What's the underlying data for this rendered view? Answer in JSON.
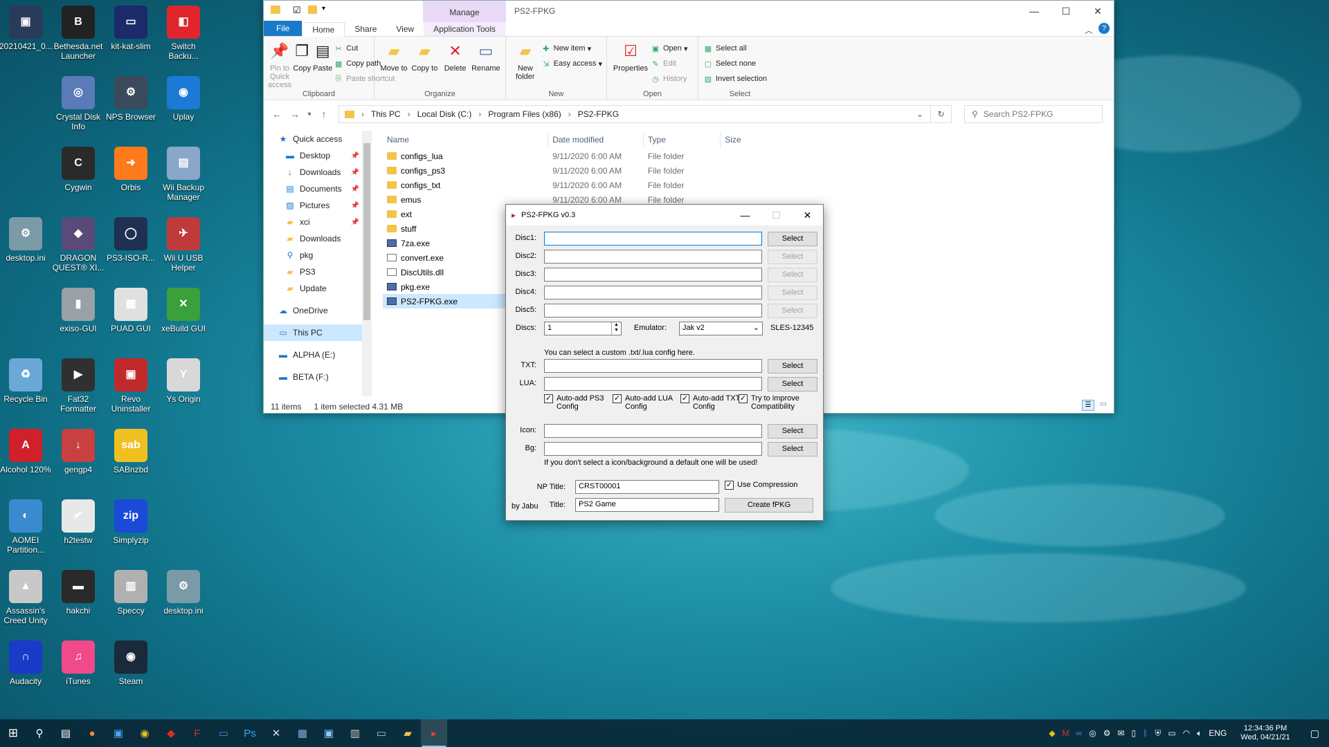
{
  "desktop": {
    "icons": [
      {
        "label": "20210421_0...",
        "color": "#2a3a5a",
        "glyph": "▣"
      },
      {
        "label": "Bethesda.net Launcher",
        "color": "#222222",
        "glyph": "B"
      },
      {
        "label": "kit-kat-slim",
        "color": "#1a2a6a",
        "glyph": "▭"
      },
      {
        "label": "Switch Backu...",
        "color": "#e0262c",
        "glyph": "◧"
      },
      {
        "label": "Crystal Disk Info",
        "color": "#5a7ab8",
        "glyph": "◎"
      },
      {
        "label": "NPS Browser",
        "color": "#3b4a5a",
        "glyph": "⚙"
      },
      {
        "label": "Uplay",
        "color": "#1b7ad6",
        "glyph": "◉"
      },
      {
        "label": "Cygwin",
        "color": "#2a2a2a",
        "glyph": "C"
      },
      {
        "label": "Orbis",
        "color": "#ff7a1a",
        "glyph": "➜"
      },
      {
        "label": "Wii Backup Manager",
        "color": "#8aa6c8",
        "glyph": "▤"
      },
      {
        "label": "desktop.ini",
        "color": "#7a9aa8",
        "glyph": "⚙"
      },
      {
        "label": "DRAGON QUEST® XI...",
        "color": "#5a4a7a",
        "glyph": "◆"
      },
      {
        "label": "PS3-ISO-R...",
        "color": "#203050",
        "glyph": "◯"
      },
      {
        "label": "Wii U USB Helper",
        "color": "#c03a3a",
        "glyph": "✈"
      },
      {
        "label": "exiso-GUI",
        "color": "#9aa0a8",
        "glyph": "▮"
      },
      {
        "label": "PUAD GUI",
        "color": "#e0e0e0",
        "glyph": "▦"
      },
      {
        "label": "xeBuild GUI",
        "color": "#3aa03a",
        "glyph": "✕"
      },
      {
        "label": "Recycle Bin",
        "color": "#6aa8d8",
        "glyph": "♻"
      },
      {
        "label": "Fat32 Formatter",
        "color": "#303030",
        "glyph": "▶"
      },
      {
        "label": "Revo Uninstaller",
        "color": "#c02a2a",
        "glyph": "▣"
      },
      {
        "label": "Ys Origin",
        "color": "#d8d8d8",
        "glyph": "Y"
      },
      {
        "label": "Alcohol 120%",
        "color": "#d0202a",
        "glyph": "A"
      },
      {
        "label": "gengp4",
        "color": "#c84040",
        "glyph": "↓"
      },
      {
        "label": "SABnzbd",
        "color": "#f0c020",
        "glyph": "sab"
      },
      {
        "label": "AOMEI Partition...",
        "color": "#3a8ad0",
        "glyph": "◐"
      },
      {
        "label": "h2testw",
        "color": "#e8e8e8",
        "glyph": "✔"
      },
      {
        "label": "Simplyzip",
        "color": "#1a4ad8",
        "glyph": "zip"
      },
      {
        "label": "Assassin's Creed Unity",
        "color": "#c8c8c8",
        "glyph": "▲"
      },
      {
        "label": "hakchi",
        "color": "#2a2a2a",
        "glyph": "▬"
      },
      {
        "label": "Speccy",
        "color": "#b0b0b0",
        "glyph": "▥"
      },
      {
        "label": "desktop.ini",
        "color": "#7a9aa8",
        "glyph": "⚙"
      },
      {
        "label": "Audacity",
        "color": "#1a3ac8",
        "glyph": "∩"
      },
      {
        "label": "iTunes",
        "color": "#f04a8a",
        "glyph": "♫"
      },
      {
        "label": "Steam",
        "color": "#1a2a3a",
        "glyph": "◉"
      }
    ]
  },
  "explorer": {
    "manage_label": "Manage",
    "window_title": "PS2-FPKG",
    "tabs": {
      "file": "File",
      "home": "Home",
      "share": "Share",
      "view": "View",
      "app_tools": "Application Tools"
    },
    "ribbon": {
      "pin": "Pin to Quick access",
      "copy": "Copy",
      "paste": "Paste",
      "cut": "Cut",
      "copy_path": "Copy path",
      "paste_shortcut": "Paste shortcut",
      "clipboard": "Clipboard",
      "move_to": "Move to",
      "copy_to": "Copy to",
      "delete": "Delete",
      "rename": "Rename",
      "organize": "Organize",
      "new_folder": "New folder",
      "new_item": "New item",
      "easy_access": "Easy access",
      "new": "New",
      "properties": "Properties",
      "open": "Open",
      "edit": "Edit",
      "history": "History",
      "open_group": "Open",
      "select_all": "Select all",
      "select_none": "Select none",
      "invert_selection": "Invert selection",
      "select": "Select"
    },
    "breadcrumb": [
      "This PC",
      "Local Disk (C:)",
      "Program Files (x86)",
      "PS2-FPKG"
    ],
    "search_placeholder": "Search PS2-FPKG",
    "nav": [
      {
        "label": "Quick access",
        "icon": "★",
        "pinned": false
      },
      {
        "label": "Desktop",
        "icon": "▬",
        "pinned": true
      },
      {
        "label": "Downloads",
        "icon": "↓",
        "pinned": true
      },
      {
        "label": "Documents",
        "icon": "▤",
        "pinned": true
      },
      {
        "label": "Pictures",
        "icon": "▨",
        "pinned": true
      },
      {
        "label": "xci",
        "icon": "▰",
        "pinned": true
      },
      {
        "label": "Downloads",
        "icon": "▰",
        "pinned": false
      },
      {
        "label": "pkg",
        "icon": "⚲",
        "pinned": false
      },
      {
        "label": "PS3",
        "icon": "▰",
        "pinned": false
      },
      {
        "label": "Update",
        "icon": "▰",
        "pinned": false
      },
      {
        "label": "OneDrive",
        "icon": "☁",
        "pinned": false
      },
      {
        "label": "This PC",
        "icon": "▭",
        "pinned": false
      },
      {
        "label": "ALPHA (E:)",
        "icon": "▬",
        "pinned": false
      },
      {
        "label": "BETA (F:)",
        "icon": "▬",
        "pinned": false
      }
    ],
    "columns": {
      "name": "Name",
      "date": "Date modified",
      "type": "Type",
      "size": "Size"
    },
    "files": [
      {
        "name": "configs_lua",
        "date": "9/11/2020 6:00 AM",
        "type": "File folder",
        "size": "",
        "kind": "folder"
      },
      {
        "name": "configs_ps3",
        "date": "9/11/2020 6:00 AM",
        "type": "File folder",
        "size": "",
        "kind": "folder"
      },
      {
        "name": "configs_txt",
        "date": "9/11/2020 6:00 AM",
        "type": "File folder",
        "size": "",
        "kind": "folder"
      },
      {
        "name": "emus",
        "date": "9/11/2020 6:00 AM",
        "type": "File folder",
        "size": "",
        "kind": "folder"
      },
      {
        "name": "ext",
        "date": "",
        "type": "",
        "size": "",
        "kind": "folder"
      },
      {
        "name": "stuff",
        "date": "",
        "type": "",
        "size": "",
        "kind": "folder"
      },
      {
        "name": "7za.exe",
        "date": "",
        "type": "",
        "size": "",
        "kind": "exe"
      },
      {
        "name": "convert.exe",
        "date": "",
        "type": "",
        "size": "",
        "kind": "dll"
      },
      {
        "name": "DiscUtils.dll",
        "date": "",
        "type": "",
        "size": "",
        "kind": "dll"
      },
      {
        "name": "pkg.exe",
        "date": "",
        "type": "",
        "size": "",
        "kind": "exe"
      },
      {
        "name": "PS2-FPKG.exe",
        "date": "",
        "type": "",
        "size": "",
        "kind": "exe"
      }
    ],
    "status": {
      "count": "11 items",
      "selection": "1 item selected  4.31 MB"
    }
  },
  "dialog": {
    "title": "PS2-FPKG v0.3",
    "disc_labels": [
      "Disc1:",
      "Disc2:",
      "Disc3:",
      "Disc4:",
      "Disc5:"
    ],
    "select_label": "Select",
    "discs_label": "Discs:",
    "discs_value": "1",
    "emulator_label": "Emulator:",
    "emulator_value": "Jak v2",
    "serial": "SLES-12345",
    "config_note": "You can select a custom .txt/.lua config here.",
    "txt_label": "TXT:",
    "lua_label": "LUA:",
    "checks": [
      {
        "label": "Auto-add PS3 Config",
        "checked": true
      },
      {
        "label": "Auto-add LUA Config",
        "checked": true
      },
      {
        "label": "Auto-add TXT Config",
        "checked": true
      },
      {
        "label": "Try to improve Compatibility",
        "checked": true
      }
    ],
    "icon_label": "Icon:",
    "bg_label": "Bg:",
    "default_note": "If you don't select a icon/background a default one will be used!",
    "np_title_label": "NP Title:",
    "np_title_value": "CRST00001",
    "use_compression": "Use Compression",
    "title_label": "Title:",
    "title_value": "PS2 Game",
    "create_button": "Create fPKG",
    "by": "by Jabu"
  },
  "taskbar": {
    "lang": "ENG",
    "time": "12:34:36 PM",
    "date": "Wed, 04/21/21"
  }
}
